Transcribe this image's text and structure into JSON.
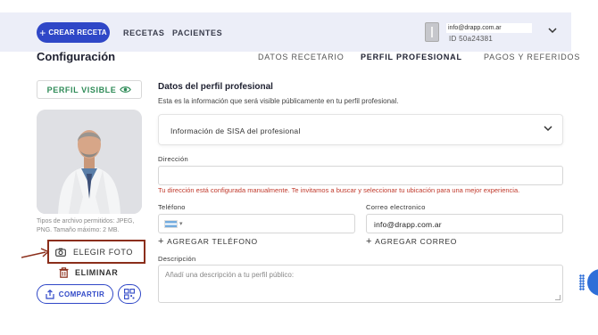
{
  "header": {
    "create_button": "CREAR RECETA",
    "nav": [
      "RECETAS",
      "PACIENTES"
    ],
    "account_email": "info@drapp.com.ar",
    "account_id": "ID 50a24381"
  },
  "page": {
    "title": "Configuración",
    "tabs": [
      {
        "label": "DATOS RECETARIO",
        "active": false
      },
      {
        "label": "PERFIL PROFESIONAL",
        "active": true
      },
      {
        "label": "PAGOS Y REFERIDOS",
        "active": false
      }
    ]
  },
  "left": {
    "visibility_label": "PERFIL VISIBLE",
    "file_hint": "Tipos de archivo permitidos: JPEG, PNG. Tamaño máximo: 2 MB.",
    "choose_photo": "ELEGIR FOTO",
    "delete": "ELIMINAR",
    "share": "COMPARTIR"
  },
  "form": {
    "title": "Datos del perfil profesional",
    "subtitle": "Esta es la información que será visible públicamente en tu perfil profesional.",
    "sisa_label": "Información de SISA del profesional",
    "address_label": "Dirección",
    "address_value": "",
    "address_warning": "Tu dirección está configurada manualmente. Te invitamos a buscar y seleccionar tu ubicación para una mejor experiencia.",
    "phone_label": "Teléfono",
    "phone_value": "",
    "email_label": "Correo electronico",
    "email_value": "info@drapp.com.ar",
    "add_phone": "AGREGAR TELÉFONO",
    "add_email": "AGREGAR CORREO",
    "description_label": "Descripción",
    "description_placeholder": "Añadí una descripción a tu perfil público:"
  },
  "colors": {
    "primary": "#2f47c7",
    "visible_green": "#2e8b57",
    "warning_red": "#c0392b",
    "highlight": "#8b2e1a"
  }
}
